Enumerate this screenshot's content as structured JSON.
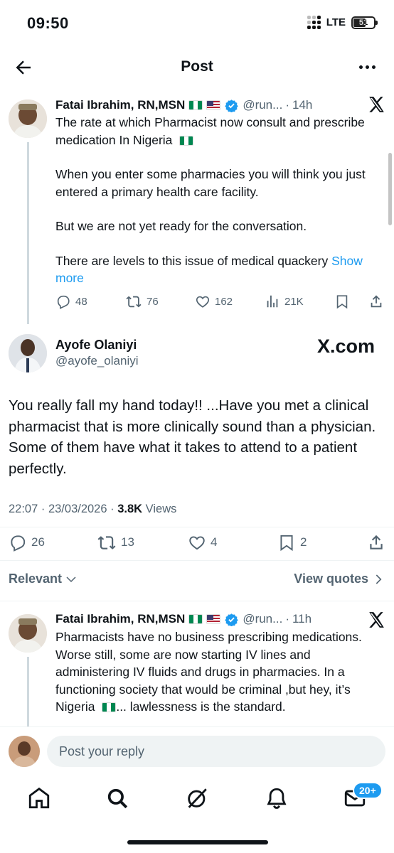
{
  "status_bar": {
    "time": "09:50",
    "network": "LTE",
    "battery": "51"
  },
  "header": {
    "title": "Post"
  },
  "parent_tweet": {
    "author": "Fatai Ibrahim, RN,MSN",
    "handle": "@run...",
    "time": "14h",
    "paragraphs": [
      "The rate at which Pharmacist now consult and prescribe medication In Nigeria",
      "When you enter some pharmacies you will think you just entered a primary health care facility.",
      "But we are not yet ready for the conversation."
    ],
    "last_paragraph": "There are levels to this issue of medical quackery",
    "show_more": "Show more",
    "replies": "48",
    "reposts": "76",
    "likes": "162",
    "views": "21K"
  },
  "main_tweet": {
    "author": "Ayofe Olaniyi",
    "handle": "@ayofe_olaniyi",
    "source_label": "X.com",
    "text": "You really fall my hand today!! ...Have you met a clinical pharmacist that is more clinically sound than a physician.  Some of them have what it takes to attend to a patient perfectly.",
    "timestamp": "22:07 · 23/03/2026 · ",
    "views_count": "3.8K",
    "views_label": " Views",
    "replies": "26",
    "reposts": "13",
    "likes": "4",
    "bookmarks": "2"
  },
  "sort": {
    "relevant_label": "Relevant",
    "view_quotes_label": "View quotes"
  },
  "reply_tweet": {
    "author": "Fatai Ibrahim, RN,MSN",
    "handle": "@run...",
    "time": "11h",
    "text": "Pharmacists have no business prescribing medications. Worse still, some are now starting IV lines and administering IV fluids and drugs in pharmacies. In a functioning society that would be criminal ,but hey, it’s Nigeria",
    "text_tail": "... lawlessness is the standard."
  },
  "reply_bar": {
    "placeholder": "Post your reply"
  },
  "tab_bar": {
    "messages_badge": "20+"
  },
  "colors": {
    "accent": "#1d9bf0",
    "text": "#0f1419",
    "muted": "#536471"
  }
}
